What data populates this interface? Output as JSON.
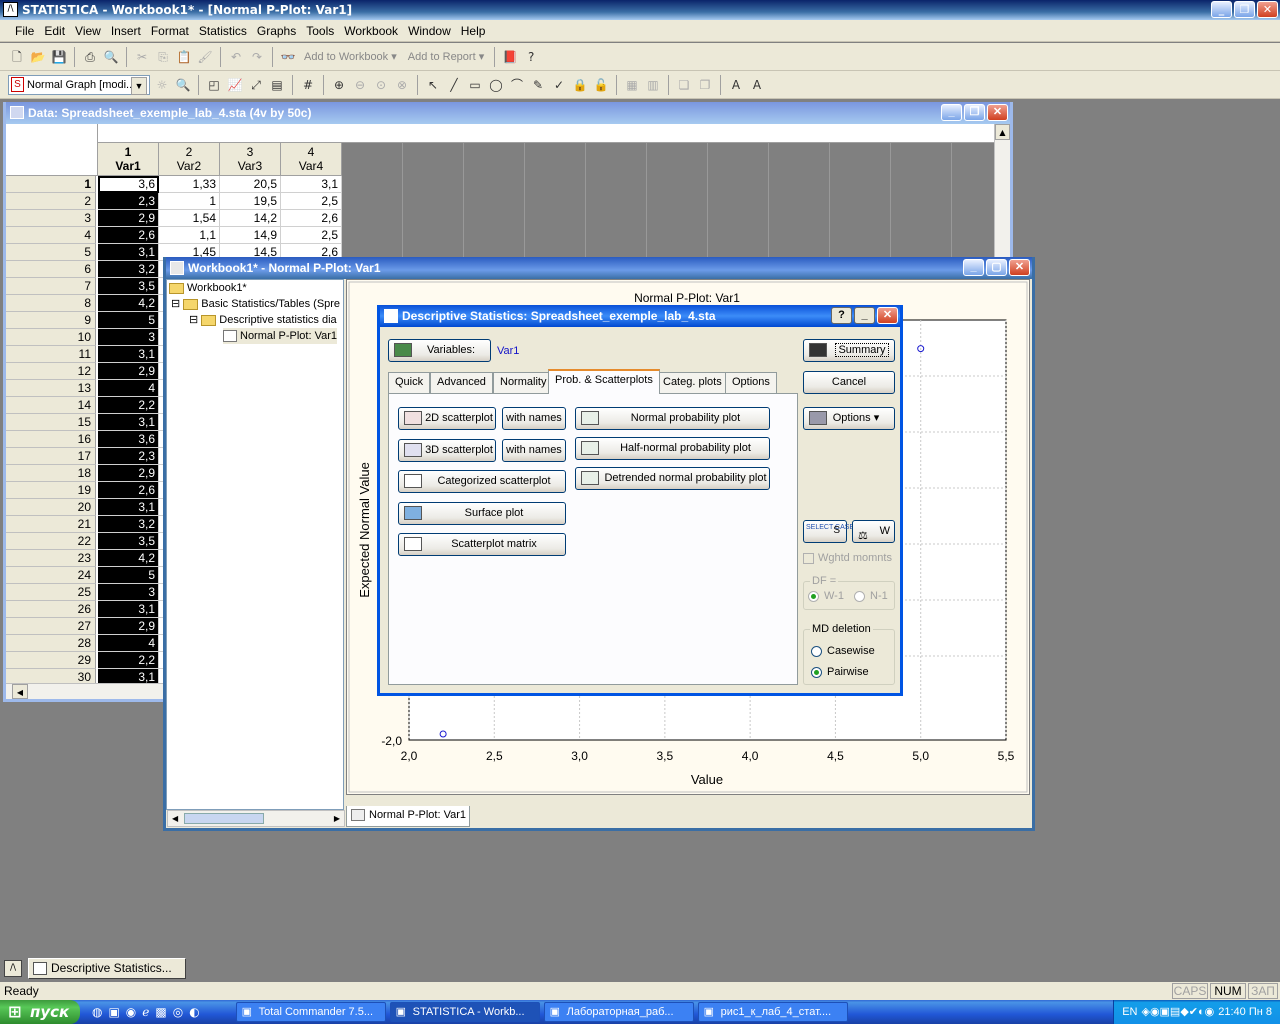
{
  "app": {
    "title": "STATISTICA - Workbook1* - [Normal P-Plot: Var1]"
  },
  "menu": [
    "File",
    "Edit",
    "View",
    "Insert",
    "Format",
    "Statistics",
    "Graphs",
    "Tools",
    "Workbook",
    "Window",
    "Help"
  ],
  "toolbar1": {
    "add_to_workbook": "Add to Workbook ▾",
    "add_to_report": "Add to Report ▾"
  },
  "toolbar2": {
    "graph_combo": "Normal Graph [modi..."
  },
  "spreadsheet": {
    "title": "Data: Spreadsheet_exemple_lab_4.sta (4v by 50c)",
    "columns": [
      {
        "num": "1",
        "name": "Var1"
      },
      {
        "num": "2",
        "name": "Var2"
      },
      {
        "num": "3",
        "name": "Var3"
      },
      {
        "num": "4",
        "name": "Var4"
      }
    ],
    "rows": [
      [
        "1",
        "3,6",
        "1,33",
        "20,5",
        "3,1"
      ],
      [
        "2",
        "2,3",
        "1",
        "19,5",
        "2,5"
      ],
      [
        "3",
        "2,9",
        "1,54",
        "14,2",
        "2,6"
      ],
      [
        "4",
        "2,6",
        "1,1",
        "14,9",
        "2,5"
      ],
      [
        "5",
        "3,1",
        "1,45",
        "14,5",
        "2,6"
      ],
      [
        "6",
        "3,2",
        "",
        "",
        ""
      ],
      [
        "7",
        "3,5",
        "",
        "",
        ""
      ],
      [
        "8",
        "4,2",
        "",
        "",
        ""
      ],
      [
        "9",
        "5",
        "",
        "",
        ""
      ],
      [
        "10",
        "3",
        "",
        "",
        ""
      ],
      [
        "11",
        "3,1",
        "",
        "",
        ""
      ],
      [
        "12",
        "2,9",
        "",
        "",
        ""
      ],
      [
        "13",
        "4",
        "",
        "",
        ""
      ],
      [
        "14",
        "2,2",
        "",
        "",
        ""
      ],
      [
        "15",
        "3,1",
        "",
        "",
        ""
      ],
      [
        "16",
        "3,6",
        "",
        "",
        ""
      ],
      [
        "17",
        "2,3",
        "",
        "",
        ""
      ],
      [
        "18",
        "2,9",
        "",
        "",
        ""
      ],
      [
        "19",
        "2,6",
        "",
        "",
        ""
      ],
      [
        "20",
        "3,1",
        "",
        "",
        ""
      ],
      [
        "21",
        "3,2",
        "",
        "",
        ""
      ],
      [
        "22",
        "3,5",
        "",
        "",
        ""
      ],
      [
        "23",
        "4,2",
        "",
        "",
        ""
      ],
      [
        "24",
        "5",
        "",
        "",
        ""
      ],
      [
        "25",
        "3",
        "",
        "",
        ""
      ],
      [
        "26",
        "3,1",
        "",
        "",
        ""
      ],
      [
        "27",
        "2,9",
        "",
        "",
        ""
      ],
      [
        "28",
        "4",
        "",
        "",
        ""
      ],
      [
        "29",
        "2,2",
        "",
        "",
        ""
      ],
      [
        "30",
        "3,1",
        "",
        "",
        ""
      ]
    ]
  },
  "workbook": {
    "title": "Workbook1* - Normal P-Plot: Var1",
    "tree": [
      "Workbook1*",
      "Basic Statistics/Tables (Spre",
      "Descriptive statistics dia",
      "Normal P-Plot: Var1"
    ],
    "tab": "Normal P-Plot: Var1"
  },
  "chart_data": {
    "type": "scatter",
    "title": "Normal P-Plot: Var1",
    "xlabel": "Value",
    "ylabel": "Expected Normal Value",
    "xlim": [
      2.0,
      5.5
    ],
    "xticks": [
      "2,0",
      "2,5",
      "3,0",
      "3,5",
      "4,0",
      "4,5",
      "5,0",
      "5,5"
    ],
    "yticks_visible": [
      "-2,0"
    ],
    "points": [
      {
        "x": 2.2,
        "y": -2.0
      },
      {
        "x": 5.0,
        "y": 2.1
      }
    ]
  },
  "dialog": {
    "title": "Descriptive Statistics: Spreadsheet_exemple_lab_4.sta",
    "variables_label": "Variables:",
    "variables_value": "Var1",
    "summary": "Summary",
    "cancel": "Cancel",
    "options": "Options",
    "tabs": [
      "Quick",
      "Advanced",
      "Normality",
      "Prob. & Scatterplots",
      "Categ. plots",
      "Options"
    ],
    "buttons_left": [
      "2D scatterplot",
      "3D scatterplot",
      "Categorized scatterplot",
      "Surface plot",
      "Scatterplot matrix"
    ],
    "with_names": "with names",
    "buttons_right": [
      "Normal probability plot",
      "Half-normal probability plot",
      "Detrended normal probability plot"
    ],
    "select_cases": "SELECT CASES",
    "s_label": "S",
    "w_label": "W",
    "wghtd": "Wghtd momnts",
    "df_label": "DF =",
    "df_w1": "W-1",
    "df_n1": "N-1",
    "md_label": "MD deletion",
    "casewise": "Casewise",
    "pairwise": "Pairwise"
  },
  "bottom_task": "Descriptive Statistics...",
  "status": {
    "ready": "Ready",
    "caps": "CAPS",
    "num": "NUM",
    "zap": "ЗАП"
  },
  "taskbar": {
    "start": "пуск",
    "tasks": [
      "Total Commander 7.5...",
      "STATISTICA - Workb...",
      "Лабораторная_раб...",
      "рис1_к_лаб_4_стат...."
    ],
    "lang": "EN",
    "clock": "21:40 Пн 8"
  }
}
